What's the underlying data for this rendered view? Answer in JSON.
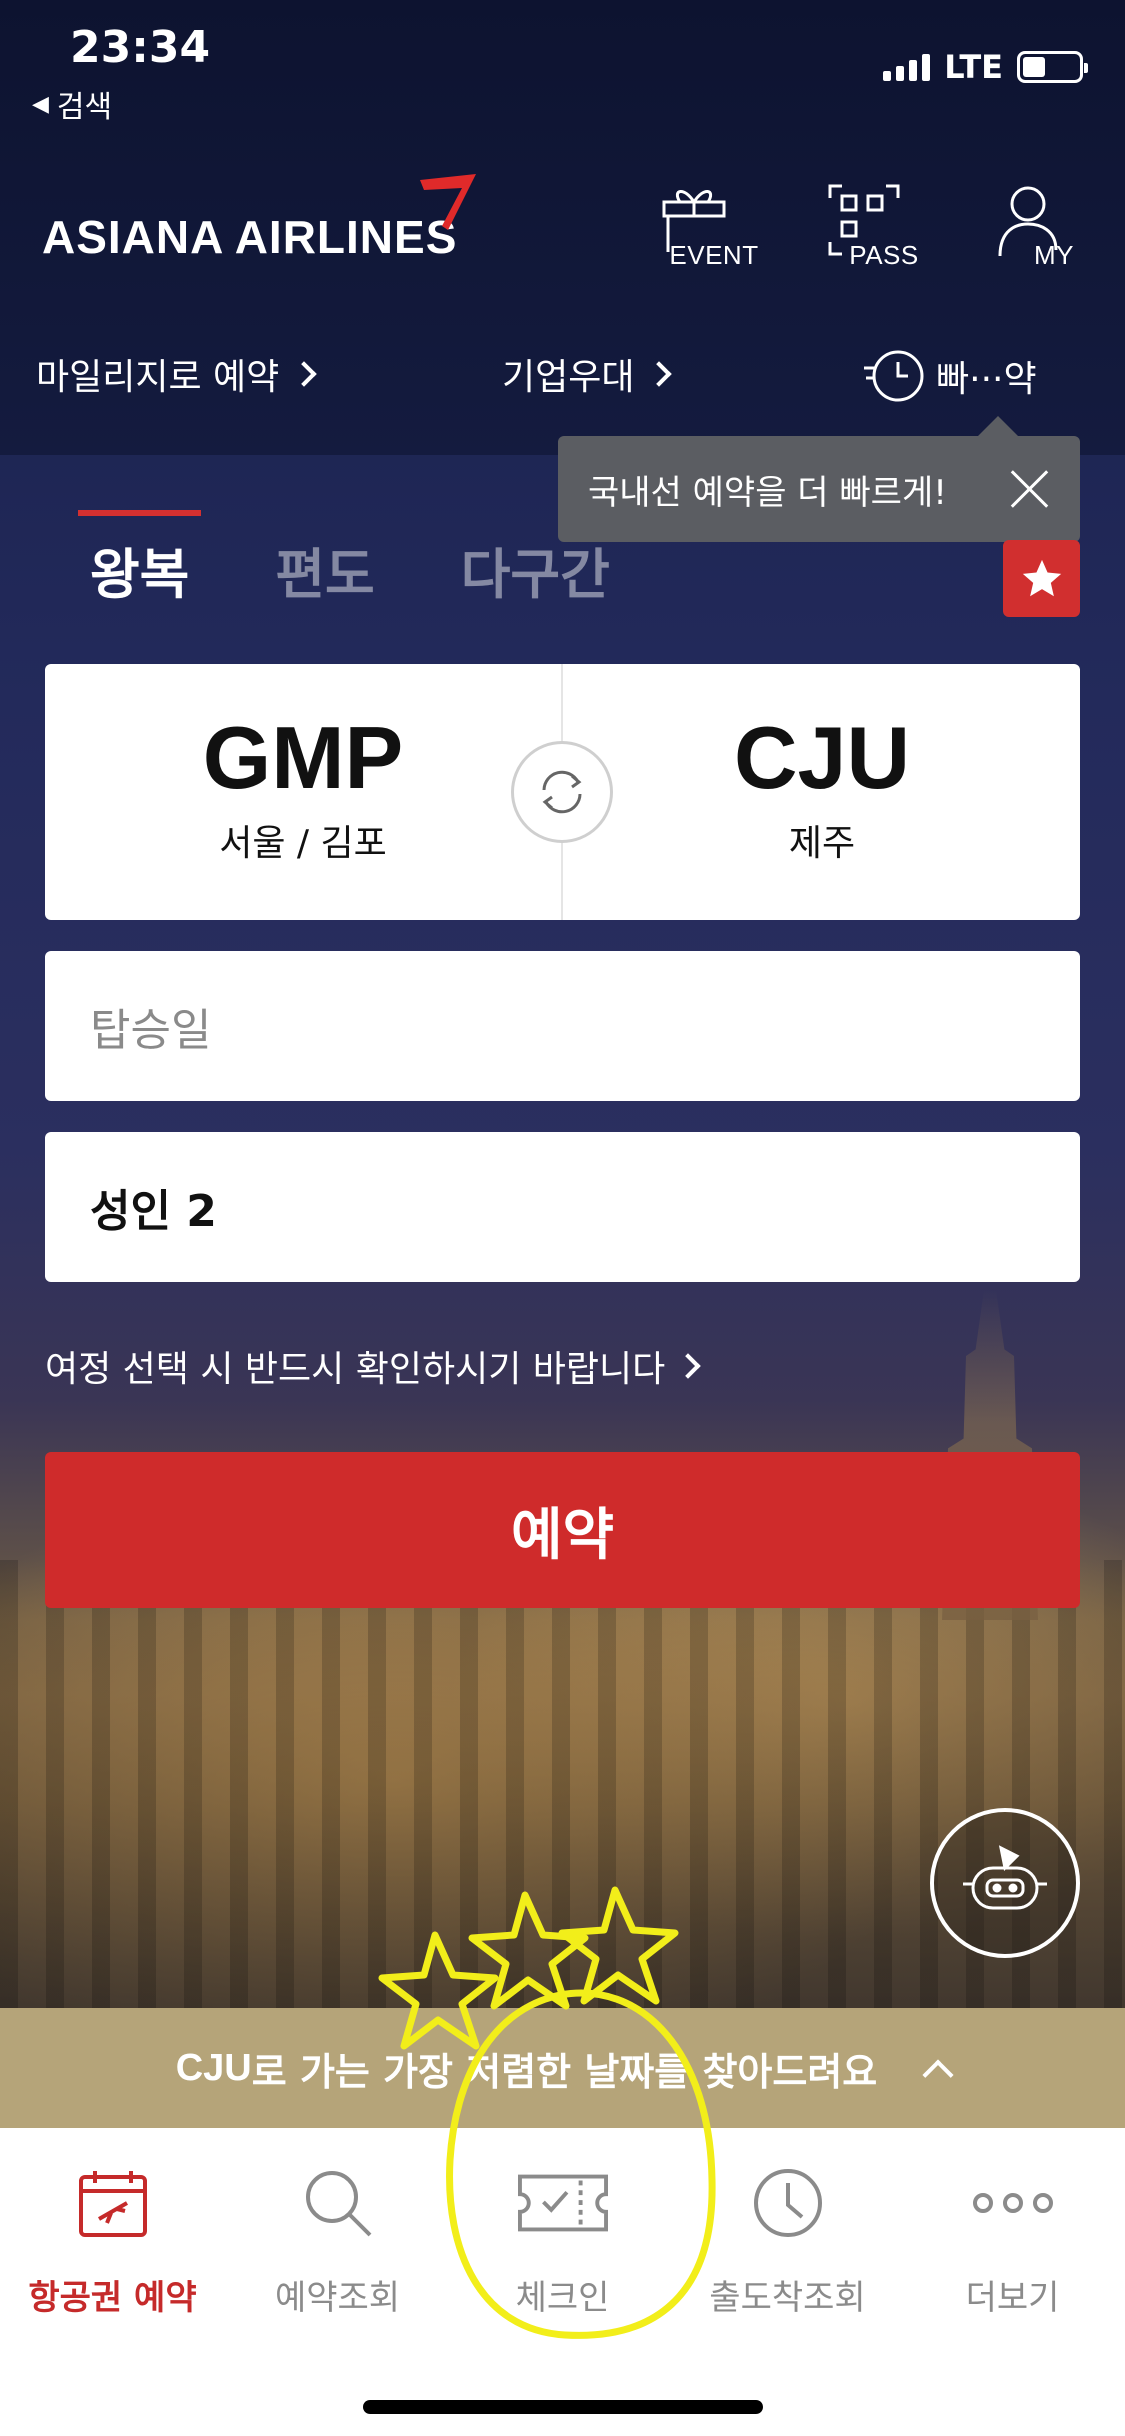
{
  "status": {
    "time": "23:34",
    "back_label": "검색",
    "network": "LTE"
  },
  "header": {
    "logo": "ASIANA AIRLINES",
    "icons": [
      {
        "name": "gift-icon",
        "label": "EVENT"
      },
      {
        "name": "qr-scan-icon",
        "label": "PASS"
      },
      {
        "name": "user-icon",
        "label": "MY"
      }
    ]
  },
  "subnav": {
    "mileage": "마일리지로 예약",
    "corporate": "기업우대",
    "quick": "빠···약"
  },
  "tooltip": {
    "text": "국내선 예약을 더 빠르게!"
  },
  "trip_tabs": [
    "왕복",
    "편도",
    "다구간"
  ],
  "route": {
    "origin_code": "GMP",
    "origin_name": "서울 / 김포",
    "dest_code": "CJU",
    "dest_name": "제주"
  },
  "fields": {
    "date_placeholder": "탑승일",
    "passengers": "성인 2"
  },
  "notice": "여정 선택 시 반드시 확인하시기 바랍니다",
  "book_button": "예약",
  "cheapest_bar": {
    "code": "CJU",
    "text": "로 가는 가장 저렴한 날짜를 찾아드려요"
  },
  "tabbar": [
    {
      "icon": "calendar-plane-icon",
      "label": "항공권 예약",
      "active": true
    },
    {
      "icon": "search-icon",
      "label": "예약조회",
      "active": false
    },
    {
      "icon": "ticket-check-icon",
      "label": "체크인",
      "active": false
    },
    {
      "icon": "clock-icon",
      "label": "출도착조회",
      "active": false
    },
    {
      "icon": "more-icon",
      "label": "더보기",
      "active": false
    }
  ],
  "colors": {
    "brand_red": "#cf2b2b",
    "cheap_bar": "#b5a479",
    "annotation_yellow": "#f2ee1a"
  }
}
